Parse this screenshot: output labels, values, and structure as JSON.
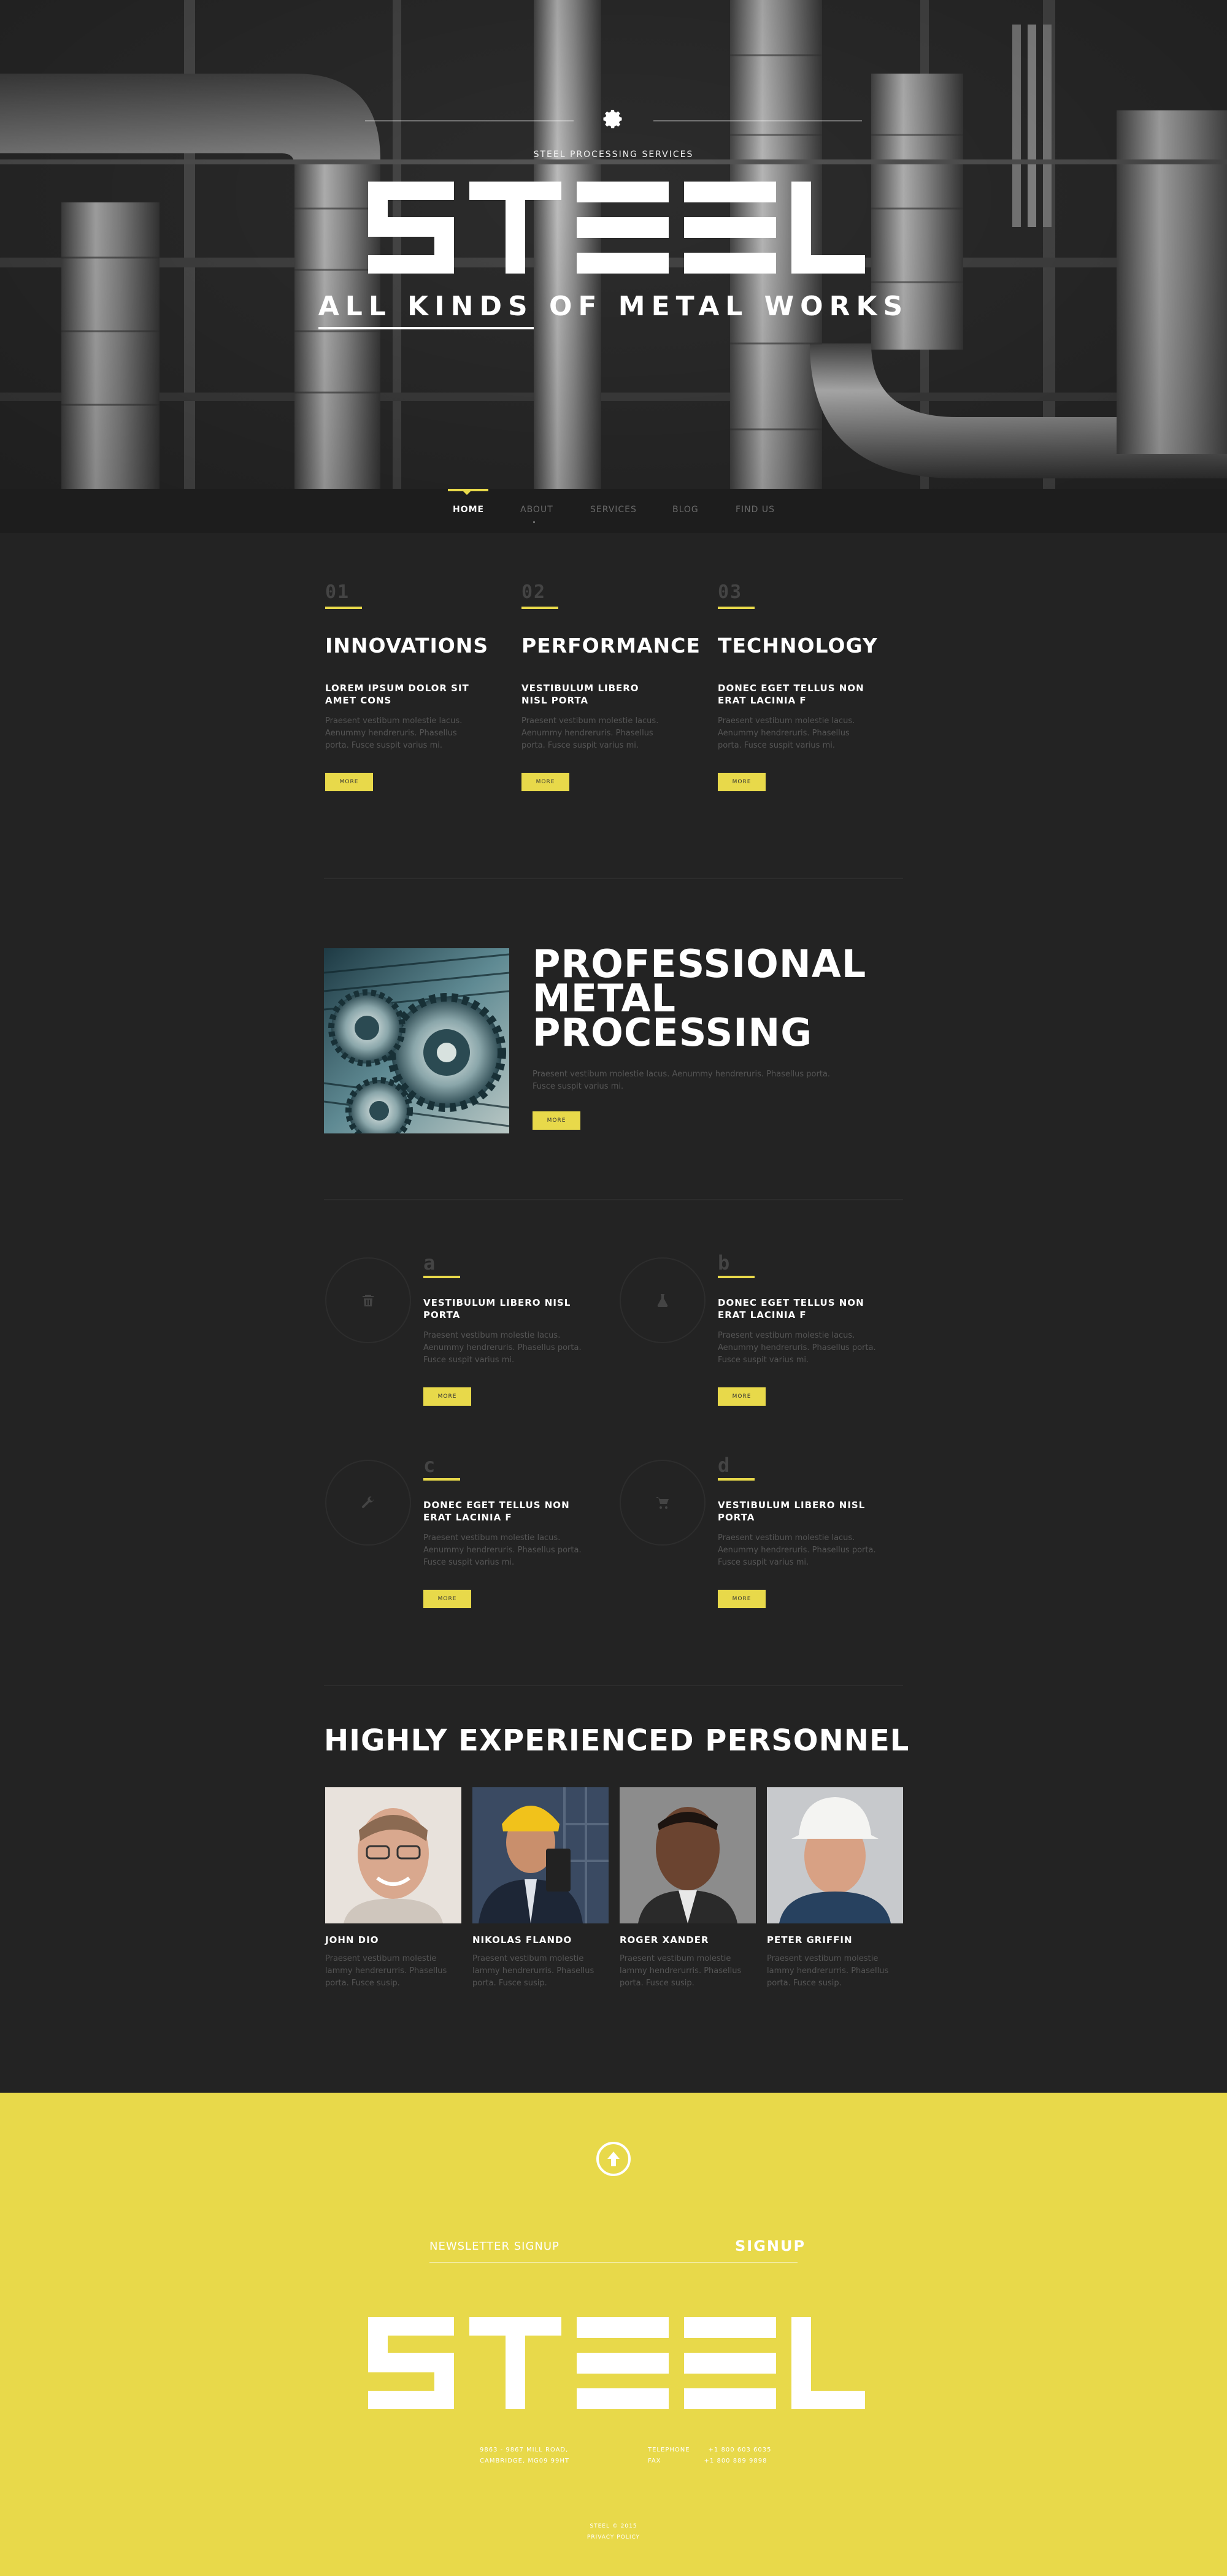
{
  "hero": {
    "tagline": "STEEL PROCESSING SERVICES",
    "title": "STEEL",
    "subtitle_underlined": "ALL KINDS",
    "subtitle_rest": " OF METAL WORKS"
  },
  "nav": {
    "items": [
      {
        "label": "HOME",
        "active": true
      },
      {
        "label": "ABOUT",
        "active": false
      },
      {
        "label": "SERVICES",
        "active": false
      },
      {
        "label": "BLOG",
        "active": false
      },
      {
        "label": "FIND US",
        "active": false
      }
    ]
  },
  "features": [
    {
      "num": "01",
      "title": "INNOVATIONS",
      "subtitle": "LOREM IPSUM DOLOR SIT AMET CONS",
      "text": "Praesent vestibum molestie lacus. Aenummy hendreruris. Phasellus porta. Fusce suspit varius mi.",
      "button": "MORE"
    },
    {
      "num": "02",
      "title": "PERFORMANCE",
      "subtitle": "VESTIBULUM LIBERO NISL PORTA",
      "text": "Praesent vestibum molestie lacus. Aenummy hendreruris. Phasellus porta. Fusce suspit varius mi.",
      "button": "MORE"
    },
    {
      "num": "03",
      "title": "TECHNOLOGY",
      "subtitle": "DONEC EGET TELLUS NON ERAT LACINIA F",
      "text": "Praesent vestibum molestie lacus. Aenummy hendreruris. Phasellus porta. Fusce suspit varius mi.",
      "button": "MORE"
    }
  ],
  "professional": {
    "title_line1": "PROFESSIONAL",
    "title_line2": "METAL",
    "title_line3": "PROCESSING",
    "text": "Praesent vestibum molestie lacus. Aenummy hendreruris. Phasellus porta. Fusce suspit varius mi.",
    "button": "MORE"
  },
  "services": [
    {
      "letter": "a",
      "icon": "trash-icon",
      "title": "VESTIBULUM LIBERO NISL PORTA",
      "text": "Praesent vestibum molestie lacus. Aenummy hendreruris. Phasellus porta. Fusce suspit varius mi.",
      "button": "MORE"
    },
    {
      "letter": "b",
      "icon": "flask-icon",
      "title": "DONEC EGET TELLUS NON ERAT LACINIA F",
      "text": "Praesent vestibum molestie lacus. Aenummy hendreruris. Phasellus porta. Fusce suspit varius mi.",
      "button": "MORE"
    },
    {
      "letter": "c",
      "icon": "wrench-icon",
      "title": "DONEC EGET TELLUS NON ERAT LACINIA F",
      "text": "Praesent vestibum molestie lacus. Aenummy hendreruris. Phasellus porta. Fusce suspit varius mi.",
      "button": "MORE"
    },
    {
      "letter": "d",
      "icon": "cart-icon",
      "title": "VESTIBULUM LIBERO NISL PORTA",
      "text": "Praesent vestibum molestie lacus. Aenummy hendreruris. Phasellus porta. Fusce suspit varius mi.",
      "button": "MORE"
    }
  ],
  "personnel": {
    "title": "HIGHLY EXPERIENCED PERSONNEL",
    "members": [
      {
        "name": "JOHN DIO",
        "text": "Praesent vestibum molestie lammy hendrerurris. Phasellus porta. Fusce susip."
      },
      {
        "name": "NIKOLAS FLANDO",
        "text": "Praesent vestibum molestie lammy hendrerurris. Phasellus porta. Fusce susip."
      },
      {
        "name": "ROGER XANDER",
        "text": "Praesent vestibum molestie lammy hendrerurris. Phasellus porta. Fusce susip."
      },
      {
        "name": "PETER GRIFFIN",
        "text": "Praesent vestibum molestie lammy hendrerurris. Phasellus porta. Fusce susip."
      }
    ]
  },
  "footer": {
    "newsletter_placeholder": "NEWSLETTER SIGNUP",
    "signup": "SIGNUP",
    "title": "STEEL",
    "address_line1": "9863 - 9867 MILL ROAD,",
    "address_line2": "CAMBRIDGE, MG09 99HT",
    "telephone_label": "TELEPHONE",
    "telephone_value": "+1 800 603 6035",
    "fax_label": "FAX",
    "fax_value": "+1 800 889 9898",
    "copyright": "STEEL © 2015",
    "privacy": "PRIVACY POLICY"
  },
  "colors": {
    "accent": "#e8d94a",
    "background": "#232323",
    "nav": "#1d1d1d",
    "text_muted": "#555555"
  }
}
